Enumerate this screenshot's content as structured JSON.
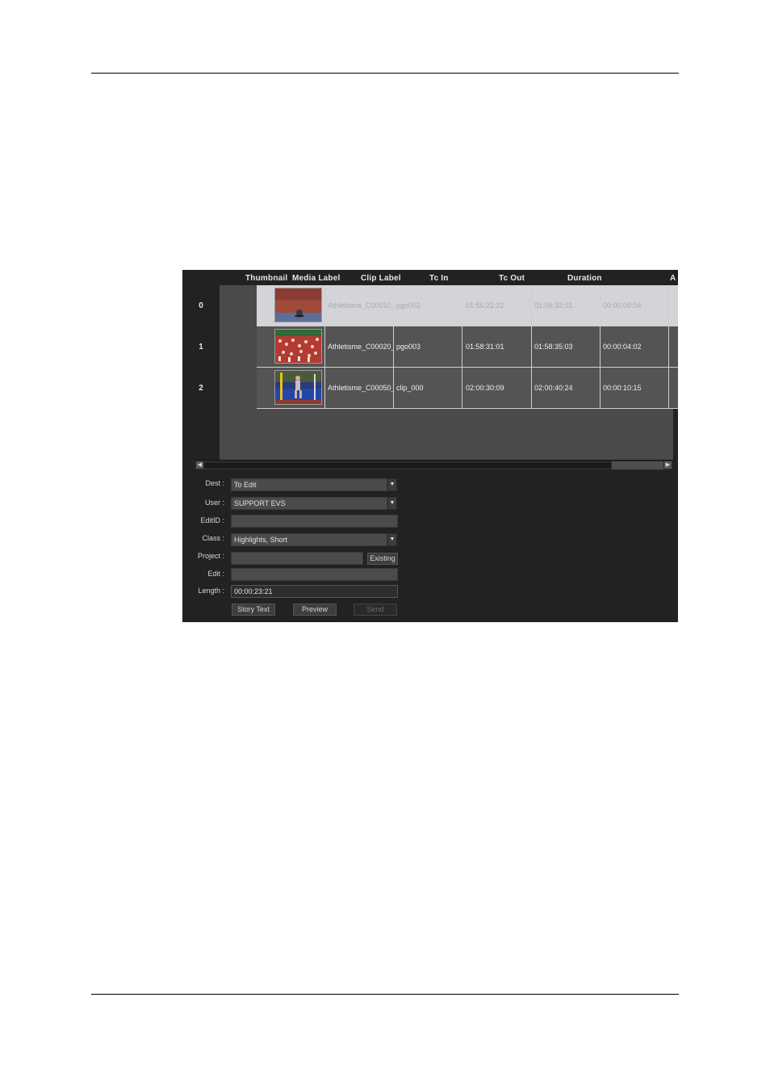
{
  "table": {
    "columns": [
      "Thumbnail",
      "Media Label",
      "Clip Label",
      "Tc In",
      "Tc Out",
      "Duration"
    ],
    "rows": [
      {
        "num": "0",
        "media_label": "Athletisme_C00010_",
        "clip_label": "pgo002",
        "tc_in": "01:56:22:22",
        "tc_out": "01:56:32:01",
        "duration": "00:00:09:04",
        "selected": true
      },
      {
        "num": "1",
        "media_label": "Athletisme_C00020_",
        "clip_label": "pgo003",
        "tc_in": "01:58:31:01",
        "tc_out": "01:58:35:03",
        "duration": "00:00:04:02",
        "selected": false
      },
      {
        "num": "2",
        "media_label": "Athletisme_C00050_",
        "clip_label": "clip_000",
        "tc_in": "02:00:30:09",
        "tc_out": "02:00:40:24",
        "duration": "00:00:10:15",
        "selected": false
      }
    ]
  },
  "form": {
    "dest_label": "Dest :",
    "dest_value": "To Edit",
    "user_label": "User :",
    "user_value": "SUPPORT EVS",
    "editid_label": "EditID :",
    "editid_value": "",
    "class_label": "Class :",
    "class_value": "Highlights, Short",
    "project_label": "Project :",
    "project_value": "",
    "existing_button": "Existing",
    "edit_label": "Edit :",
    "edit_value": "",
    "length_label": "Length :",
    "length_value": "00:00:23:21"
  },
  "buttons": {
    "story_text": "Story Text",
    "preview": "Preview",
    "send": "Send"
  },
  "colors": {
    "app_background": "#222222",
    "grid_background": "#4a4a4a",
    "selected_row": "#d3d3d8",
    "row_background": "#545454"
  }
}
